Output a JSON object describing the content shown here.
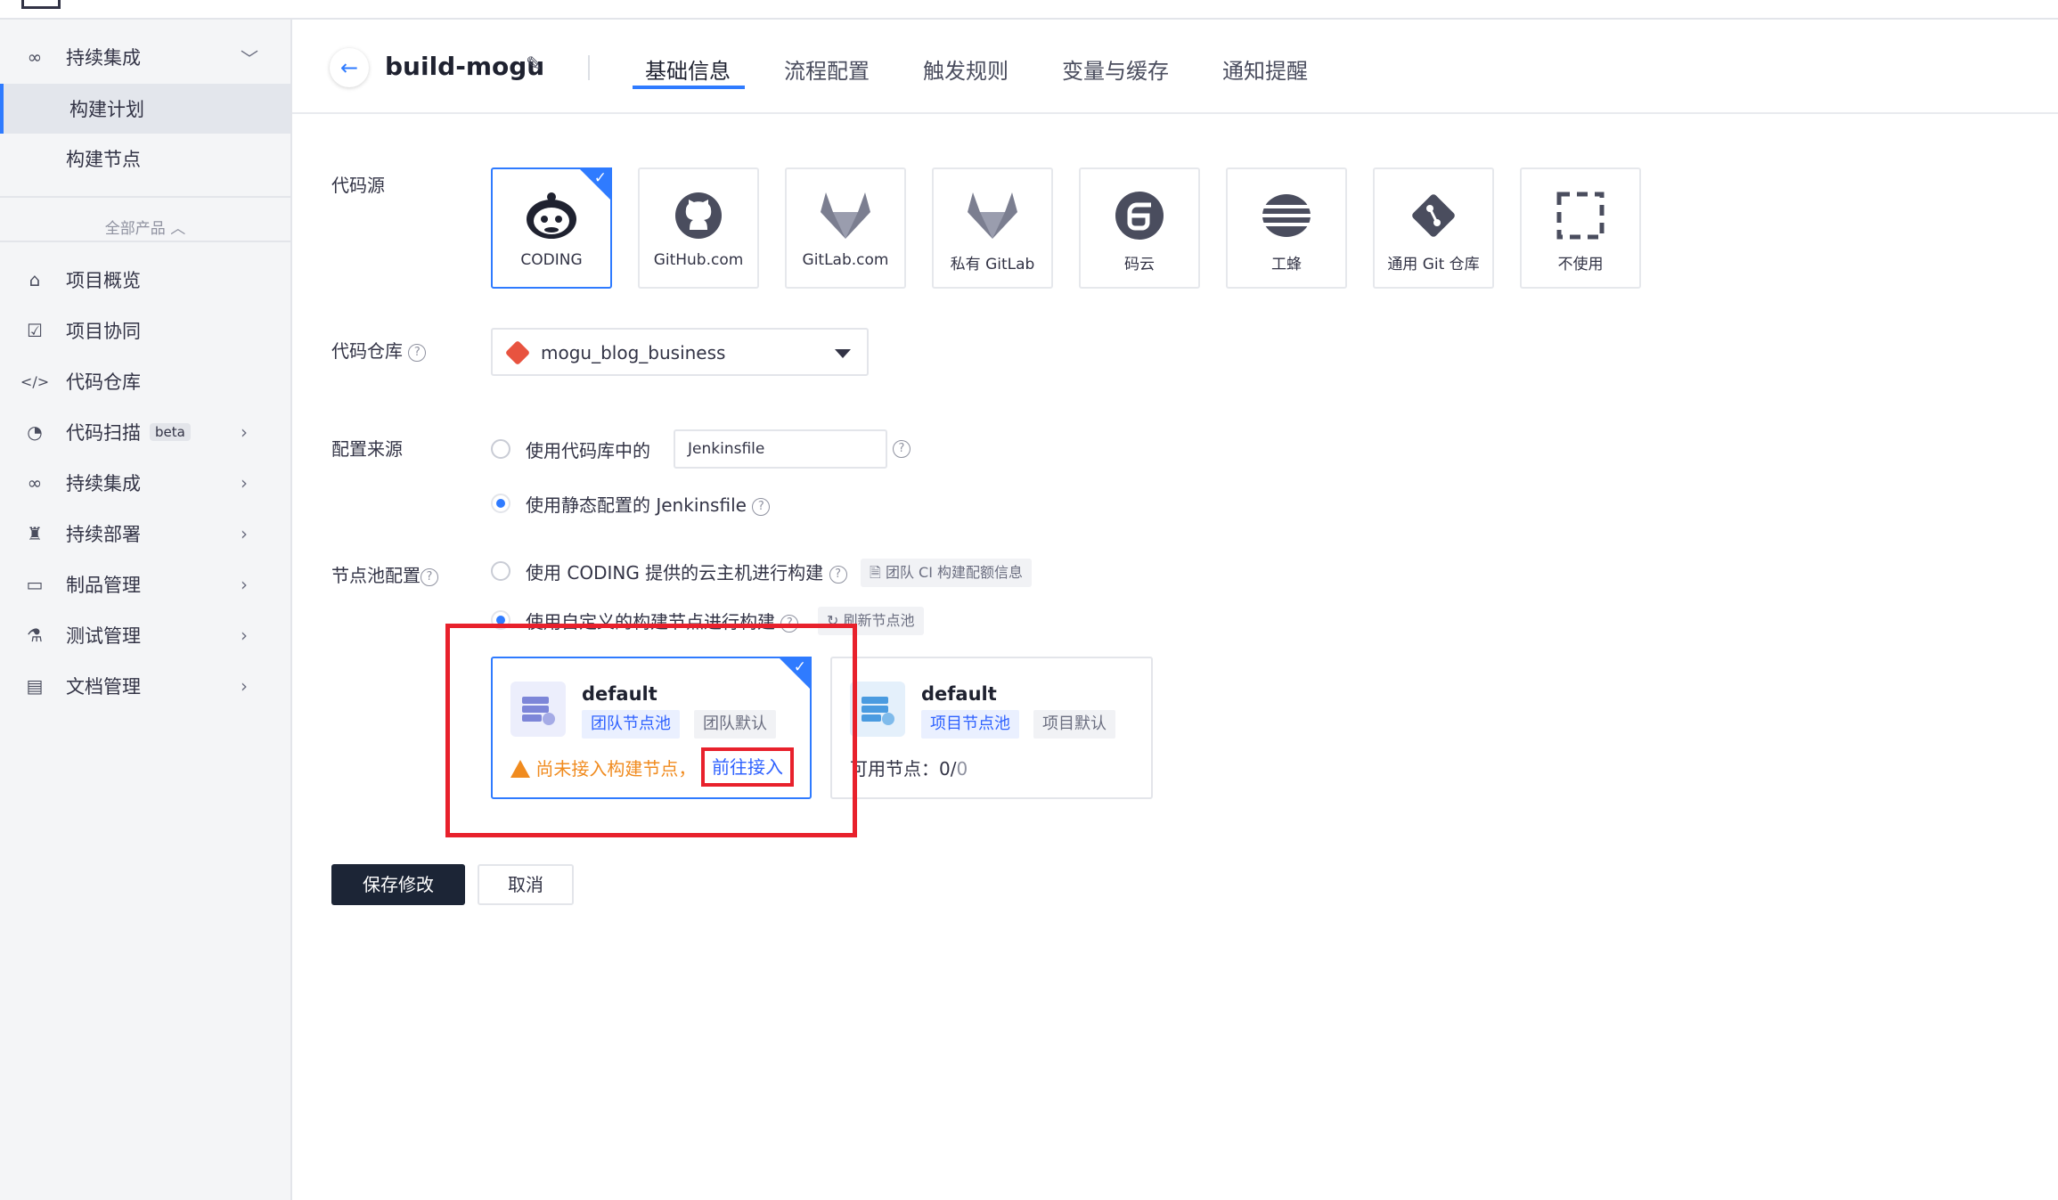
{
  "sidebar": {
    "ci_header": "持续集成",
    "ci_sub": [
      "构建计划",
      "构建节点"
    ],
    "all_products": "全部产品",
    "items": [
      {
        "label": "项目概览",
        "icon": "home-icon"
      },
      {
        "label": "项目协同",
        "icon": "checkbox-icon"
      },
      {
        "label": "代码仓库",
        "icon": "code-icon"
      },
      {
        "label": "代码扫描",
        "icon": "scan-icon",
        "badge": "beta"
      },
      {
        "label": "持续集成",
        "icon": "infinity-icon"
      },
      {
        "label": "持续部署",
        "icon": "rocket-icon"
      },
      {
        "label": "制品管理",
        "icon": "box-icon"
      },
      {
        "label": "测试管理",
        "icon": "flask-icon"
      },
      {
        "label": "文档管理",
        "icon": "book-icon"
      }
    ]
  },
  "header": {
    "title": "build-mogu",
    "tabs": [
      "基础信息",
      "流程配置",
      "触发规则",
      "变量与缓存",
      "通知提醒"
    ],
    "active_tab": "基础信息"
  },
  "form": {
    "source_label": "代码源",
    "sources": [
      "CODING",
      "GitHub.com",
      "GitLab.com",
      "私有 GitLab",
      "码云",
      "工蜂",
      "通用 Git 仓库",
      "不使用"
    ],
    "selected_source": "CODING",
    "repo_label": "代码仓库",
    "repo_value": "mogu_blog_business",
    "config_label": "配置来源",
    "config_opt1": "使用代码库中的",
    "config_file_value": "Jenkinsfile",
    "config_opt2": "使用静态配置的 Jenkinsfile",
    "pool_label": "节点池配置",
    "pool_opt1": "使用 CODING 提供的云主机进行构建",
    "pool_opt1_link": "团队 CI 构建配额信息",
    "pool_opt2": "使用自定义的构建节点进行构建",
    "refresh_label": "刷新节点池",
    "pools": [
      {
        "name": "default",
        "tag1": "团队节点池",
        "tag2": "团队默认",
        "warning": "尚未接入构建节点，",
        "link": "前往接入"
      },
      {
        "name": "default",
        "tag1": "项目节点池",
        "tag2": "项目默认",
        "available_label": "可用节点：",
        "available": "0",
        "total": "0"
      }
    ]
  },
  "buttons": {
    "save": "保存修改",
    "cancel": "取消"
  },
  "colors": {
    "accent": "#2f7bff",
    "highlight": "#e8212c",
    "warning": "#f08b1f",
    "primary_button": "#1c2536"
  }
}
